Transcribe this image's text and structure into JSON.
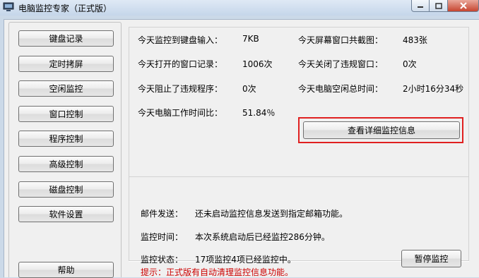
{
  "window": {
    "title": "电脑监控专家（正式版）"
  },
  "sidebar": {
    "items": [
      {
        "label": "键盘记录"
      },
      {
        "label": "定时拷屏"
      },
      {
        "label": "空闲监控"
      },
      {
        "label": "窗口控制"
      },
      {
        "label": "程序控制"
      },
      {
        "label": "高级控制"
      },
      {
        "label": "磁盘控制"
      },
      {
        "label": "软件设置"
      }
    ],
    "help_label": "帮助"
  },
  "stats": {
    "keyboard_label": "今天监控到键盘输入：",
    "keyboard_value": "7KB",
    "screenshot_label": "今天屏幕窗口共截图：",
    "screenshot_value": "483张",
    "windows_label": "今天打开的窗口记录：",
    "windows_value": "1006次",
    "closed_label": "今天关闭了违规窗口：",
    "closed_value": "0次",
    "blocked_label": "今天阻止了违规程序：",
    "blocked_value": "0次",
    "idle_label": "今天电脑空闲总时间：",
    "idle_value": "2小时16分34秒",
    "work_ratio_label": "今天电脑工作时间比：",
    "work_ratio_value": "51.84％",
    "details_button": "查看详细监控信息"
  },
  "info": {
    "mail_label": "邮件发送：",
    "mail_value": "还未启动监控信息发送到指定邮箱功能。",
    "time_label": "监控时间：",
    "time_value": "本次系统启动后已经监控286分钟。",
    "status_label": "监控状态：",
    "status_value": "17项监控4项已经监控中。",
    "pause_button": "暂停监控"
  },
  "tip": "提示：正式版有自动清理监控信息功能。",
  "colors": {
    "highlight": "#e02020",
    "tip": "#cc0000"
  }
}
